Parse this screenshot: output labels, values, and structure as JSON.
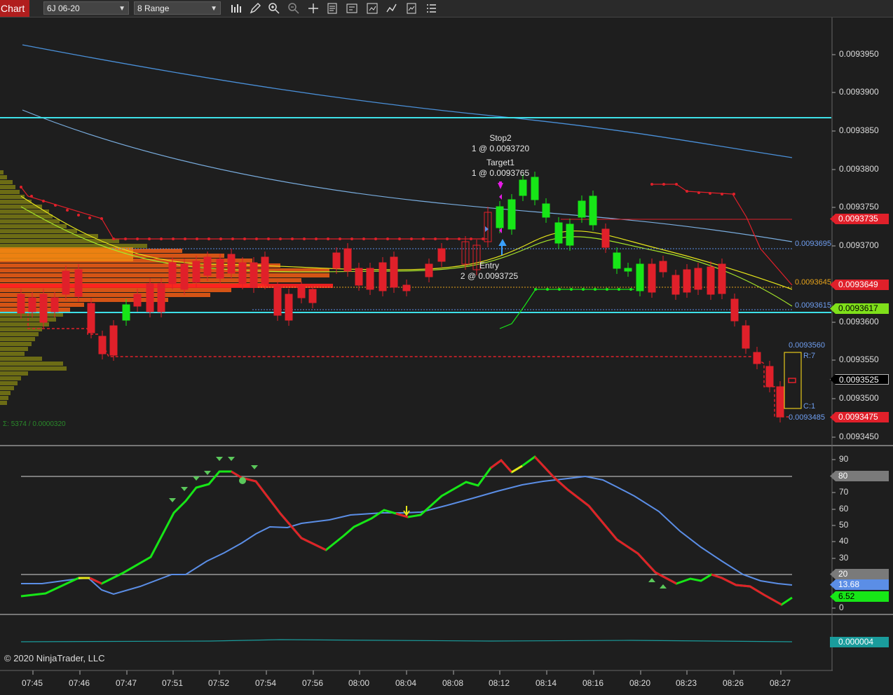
{
  "toolbar": {
    "chart_tab": "Chart",
    "instrument": "6J 06-20",
    "bar_type": "8 Range",
    "icons": [
      "bar-style-icon",
      "pencil-icon",
      "zoom-in-icon",
      "zoom-out-icon",
      "crosshair-icon",
      "properties-icon",
      "data-box-icon",
      "strategies-icon",
      "indicators-icon",
      "templates-icon"
    ]
  },
  "price_axis": {
    "ticks": [
      "0.0093950",
      "0.0093900",
      "0.0093850",
      "0.0093800",
      "0.0093750",
      "0.0093700",
      "0.0093650",
      "0.0093600",
      "0.0093550",
      "0.0093500",
      "0.0093450"
    ]
  },
  "price_markers": [
    {
      "label": "0.0093735",
      "color": "#e0202a",
      "text_color": "#ffffff"
    },
    {
      "label": "0.0093649",
      "color": "#e0202a",
      "text_color": "#ffffff"
    },
    {
      "label": "0.0093617",
      "color": "#7fe01a",
      "text_color": "#000000"
    },
    {
      "label": "0.0093525",
      "color": "#000000",
      "text_color": "#ffffff"
    },
    {
      "label": "0.0093475",
      "color": "#e0202a",
      "text_color": "#ffffff"
    }
  ],
  "inline_labels": {
    "upper_band": "0.0093695",
    "mid_band": "0.0093645",
    "lower_band": "0.0093615",
    "range_high": "0.0093560",
    "range_low": "0.0093485",
    "range_r": "R:7",
    "range_c": "C:1",
    "volume_profile": "Σ: 5374 / 0.0000320"
  },
  "orders": {
    "stop_title": "Stop2",
    "stop_detail": "1 @ 0.0093720",
    "target_title": "Target1",
    "target_detail": "1 @ 0.0093765",
    "entry_title": "Entry",
    "entry_detail": "2 @ 0.0093725"
  },
  "oscillator_axis": {
    "ticks": [
      "90",
      "70",
      "60",
      "50",
      "40",
      "30",
      "0"
    ],
    "markers": [
      {
        "label": "80",
        "color": "#7a7a7a",
        "text_color": "#ffffff"
      },
      {
        "label": "20",
        "color": "#7a7a7a",
        "text_color": "#ffffff"
      },
      {
        "label": "13.68",
        "color": "#5b8ee6",
        "text_color": "#ffffff"
      },
      {
        "label": "6.52",
        "color": "#17e617",
        "text_color": "#000000"
      }
    ]
  },
  "third_panel": {
    "marker": {
      "label": "0.000004",
      "color": "#1a9c9c",
      "text_color": "#ffffff"
    }
  },
  "time_axis": [
    "07:45",
    "07:46",
    "07:47",
    "07:51",
    "07:52",
    "07:54",
    "07:56",
    "08:00",
    "08:04",
    "08:08",
    "08:12",
    "08:14",
    "08:16",
    "08:20",
    "08:23",
    "08:26",
    "08:27"
  ],
  "copyright": "© 2020 NinjaTrader, LLC",
  "colors": {
    "background": "#1e1e1e",
    "up_candle": "#17e617",
    "down_candle": "#e0202a",
    "cyan_line": "#3ee0e8",
    "ma_blue": "#4a90d9",
    "stoch_blue": "#5b8ee6"
  }
}
